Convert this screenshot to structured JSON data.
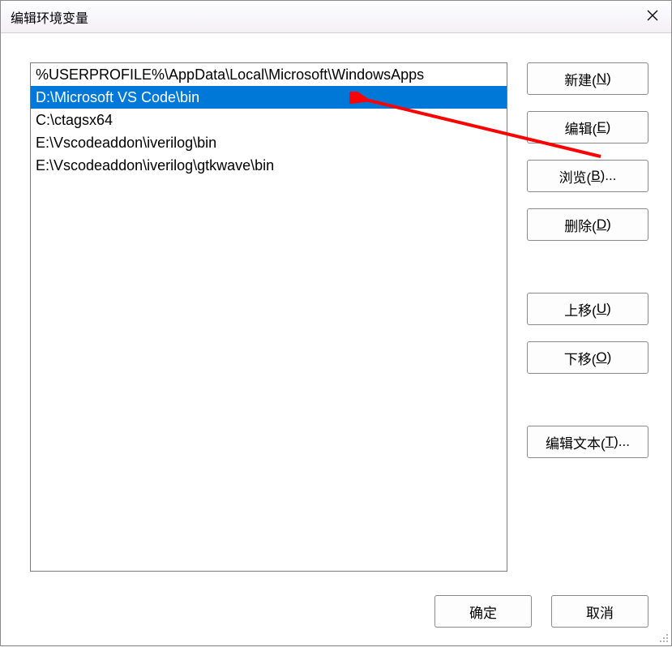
{
  "window": {
    "title": "编辑环境变量"
  },
  "list": {
    "items": [
      {
        "text": "%USERPROFILE%\\AppData\\Local\\Microsoft\\WindowsApps",
        "selected": false
      },
      {
        "text": "D:\\Microsoft VS Code\\bin",
        "selected": true
      },
      {
        "text": "C:\\ctagsx64",
        "selected": false
      },
      {
        "text": "E:\\Vscodeaddon\\iverilog\\bin",
        "selected": false
      },
      {
        "text": "E:\\Vscodeaddon\\iverilog\\gtkwave\\bin",
        "selected": false
      }
    ]
  },
  "buttons": {
    "new_pre": "新建(",
    "new_hot": "N",
    "new_post": ")",
    "edit_pre": "编辑(",
    "edit_hot": "E",
    "edit_post": ")",
    "browse_pre": "浏览(",
    "browse_hot": "B",
    "browse_post": ")...",
    "delete_pre": "删除(",
    "delete_hot": "D",
    "delete_post": ")",
    "moveup_pre": "上移(",
    "moveup_hot": "U",
    "moveup_post": ")",
    "movedown_pre": "下移(",
    "movedown_hot": "O",
    "movedown_post": ")",
    "edittext_pre": "编辑文本(",
    "edittext_hot": "T",
    "edittext_post": ")...",
    "ok": "确定",
    "cancel": "取消"
  },
  "annotation": {
    "arrow_color": "#ff0000"
  }
}
